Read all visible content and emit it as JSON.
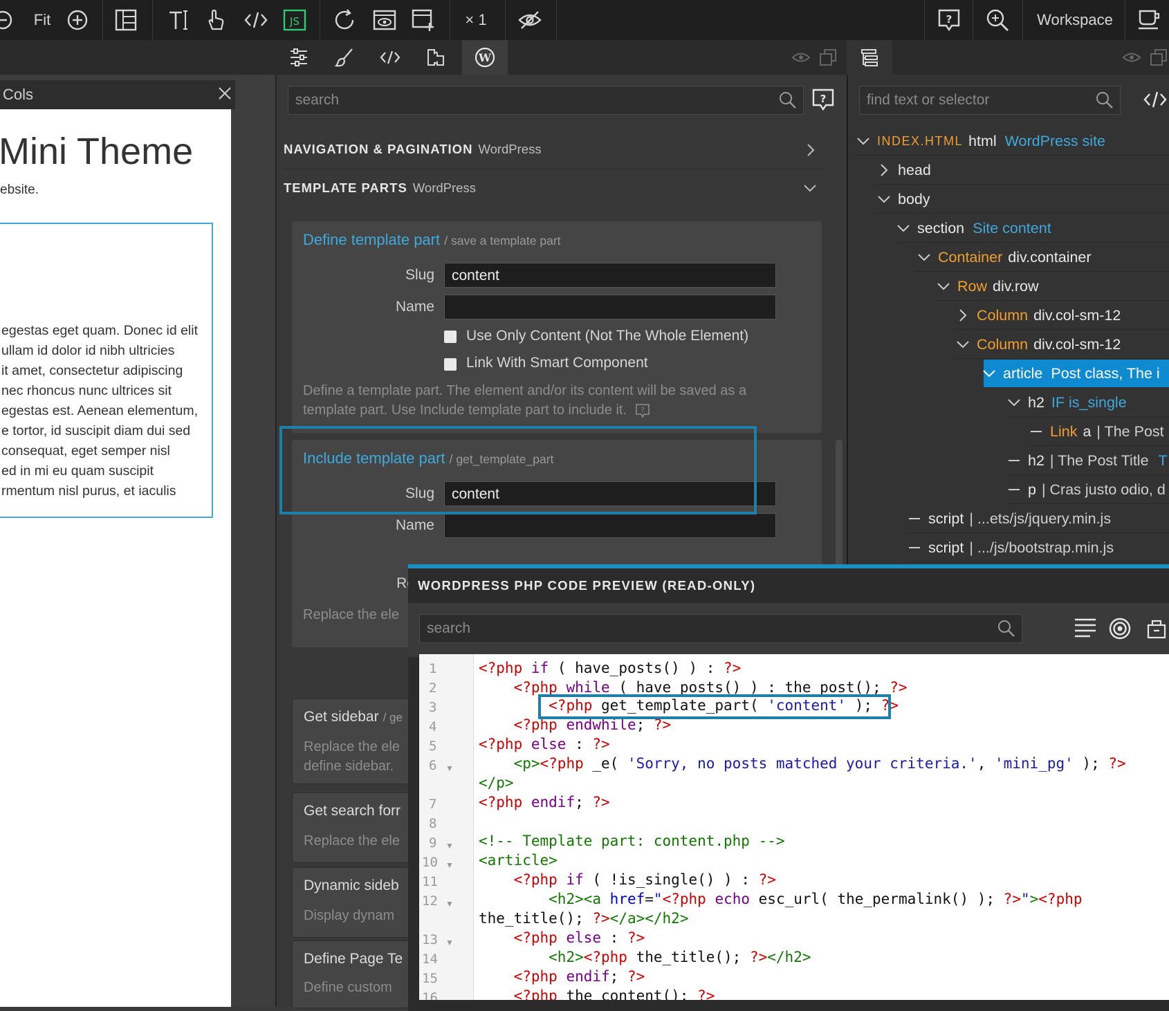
{
  "toolbar": {
    "fit_label": "Fit",
    "zoom_label": "× 1",
    "workspace_label": "Workspace",
    "js_label": "JS"
  },
  "canvas": {
    "panel_title": "Cols",
    "heading": "Mini Theme",
    "subtitle": "ebsite.",
    "paragraph_lines": [
      "egestas eget quam. Donec id elit",
      "ullam id dolor id nibh ultricies",
      "it amet, consectetur adipiscing",
      "nec rhoncus nunc ultrices sit",
      "egestas est. Aenean elementum,",
      "e tortor, id suscipit diam dui sed",
      "consequat, eget semper nisl",
      "ed in mi eu quam suscipit",
      "rmentum nisl purus, et iaculis"
    ]
  },
  "actions": {
    "search_placeholder": "search",
    "sections": [
      {
        "label": "NAVIGATION & PAGINATION",
        "tag": "WordPress"
      },
      {
        "label": "TEMPLATE PARTS",
        "tag": "WordPress"
      }
    ],
    "define_part": {
      "title": "Define template part",
      "hint": "/ save a template part",
      "slug_label": "Slug",
      "slug_value": "content",
      "name_label": "Name",
      "name_value": "",
      "check1": "Use Only Content (Not The Whole Element)",
      "check2": "Link With Smart Component",
      "desc_line1": "Define a template part. The element and/or its content will be saved as a",
      "desc_line2": "template part. Use Include template part to include it."
    },
    "include_part": {
      "title": "Include template part",
      "hint": "/ get_template_part",
      "slug_label": "Slug",
      "slug_value": "content",
      "name_label": "Name",
      "re_label": "Re",
      "desc": "Replace the ele"
    },
    "more_cards": [
      {
        "title": "Get sidebar",
        "hint": "/ ge",
        "desc1": "Replace the ele",
        "desc2": "define sidebar."
      },
      {
        "title": "Get search forr",
        "hint": "",
        "desc1": "Replace the ele",
        "desc2": ""
      },
      {
        "title": "Dynamic sideb",
        "hint": "",
        "desc1": "Display dynam",
        "desc2": ""
      },
      {
        "title": "Define Page Te",
        "hint": "",
        "desc1": "Define custom",
        "desc2": ""
      }
    ]
  },
  "tree": {
    "search_placeholder": "find text or selector",
    "nodes": [
      {
        "pre": "INDEX.HTML",
        "tag": "html",
        "label": "WordPress site"
      },
      {
        "tag": "head"
      },
      {
        "tag": "body"
      },
      {
        "tag": "section",
        "label": "Site content"
      },
      {
        "name": "Container",
        "tag": "div.container"
      },
      {
        "name": "Row",
        "tag": "div.row"
      },
      {
        "name": "Column",
        "tag": "div.col-sm-12"
      },
      {
        "name": "Column",
        "tag": "div.col-sm-12"
      },
      {
        "tag": "article",
        "label": "Post class, The i"
      },
      {
        "tag": "h2",
        "label": "IF is_single"
      },
      {
        "name": "Link",
        "tag": "a",
        "text": "| The Post"
      },
      {
        "tag": "h2",
        "text": "| The Post Title",
        "extra": "T"
      },
      {
        "tag": "p",
        "text": "| Cras justo odio, d"
      },
      {
        "tag": "script",
        "text": "| ...ets/js/jquery.min.js"
      },
      {
        "tag": "script",
        "text": "| .../js/bootstrap.min.js"
      }
    ]
  },
  "code_preview": {
    "title": "WORDPRESS PHP CODE PREVIEW (READ-ONLY)",
    "search_placeholder": "search",
    "line_numbers": [
      "1",
      "2",
      "3",
      "4",
      "5",
      "6",
      "",
      "7",
      "8",
      "9",
      "10",
      "11",
      "12",
      "",
      "13",
      "14",
      "15",
      "16"
    ]
  },
  "colors": {
    "accent_blue": "#3fa9dc",
    "highlight_frame": "#1e7fa8",
    "orange": "#f0a030",
    "selection": "#0e8ad0"
  }
}
